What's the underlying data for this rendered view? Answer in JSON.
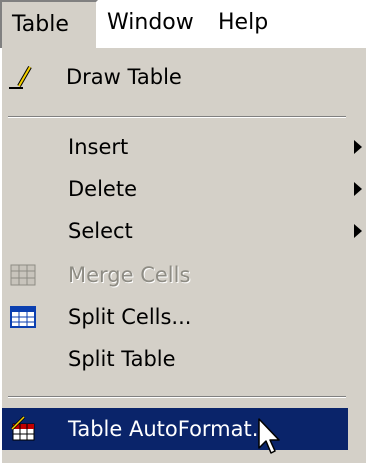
{
  "menubar": {
    "table": "Table",
    "window": "Window",
    "help": "Help"
  },
  "menu": {
    "draw_table": "Draw Table",
    "insert": "Insert",
    "delete": "Delete",
    "select": "Select",
    "merge_cells": "Merge Cells",
    "split_cells": "Split Cells...",
    "split_table": "Split Table",
    "table_autoformat": "Table AutoFormat..."
  },
  "icons": {
    "draw_table": "pencil-icon",
    "insert": "submenu-arrow-icon",
    "delete": "submenu-arrow-icon",
    "select": "submenu-arrow-icon",
    "merge_cells": "merge-cells-icon",
    "split_cells": "split-cells-icon",
    "table_autoformat": "table-autoformat-icon",
    "pointer": "mouse-pointer-icon"
  },
  "colors": {
    "menu_background": "#d4d0c8",
    "highlight": "#0a246a",
    "highlight_text": "#ffffff",
    "disabled_text": "#8e8c84"
  }
}
